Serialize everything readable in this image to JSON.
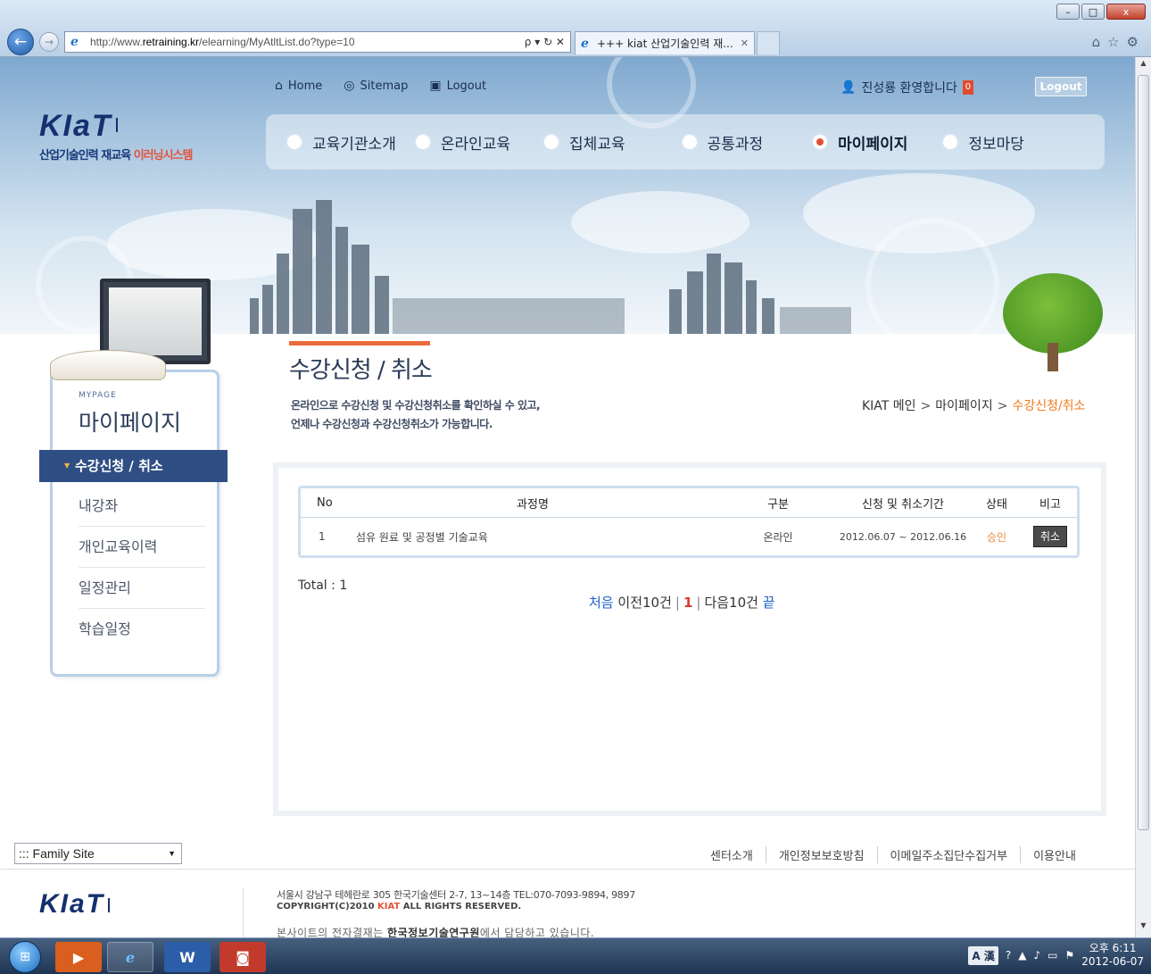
{
  "browser": {
    "url_prefix": "http://www.",
    "url_host": "retraining.kr",
    "url_path": "/elearning/MyAtltList.do?type=10",
    "addr_tools": "ρ ▾ ↻ ✕",
    "tab_title": "+++ kiat 산업기술인력 재...",
    "tab_close": "✕",
    "win_min": "–",
    "win_max": "□",
    "win_close": "x",
    "back_glyph": "←",
    "fwd_glyph": "→"
  },
  "header": {
    "logo_text": "KIaT",
    "logo_sub_main": "산업기술인력 재교육 ",
    "logo_sub_accent": "이러닝시스템",
    "util_links": [
      "Home",
      "Sitemap",
      "Logout"
    ],
    "welcome": "진성룡 환영합니다",
    "welcome_badge": "0",
    "logout_button": "Logout"
  },
  "gnb": {
    "items": [
      "교육기관소개",
      "온라인교육",
      "집체교육",
      "공통과정",
      "마이페이지",
      "정보마당"
    ],
    "active": "마이페이지"
  },
  "snb": {
    "title_en": "MYPAGE",
    "title": "마이페이지",
    "active_item": "수강신청 / 취소",
    "items": [
      "내강좌",
      "개인교육이력",
      "일정관리",
      "학습일정"
    ]
  },
  "content": {
    "page_title": "수강신청 / 취소",
    "desc_line1": "온라인으로 수강신청 및 수강신청취소를 확인하실 수 있고,",
    "desc_line2": "언제나 수강신청과 수강신청취소가 가능합니다.",
    "breadcrumb": [
      "KIAT 메인",
      "마이페이지",
      "수강신청/취소"
    ],
    "breadcrumb_sep": ">",
    "table": {
      "headers": [
        "No",
        "과정명",
        "구분",
        "신청 및 취소기간",
        "상태",
        "비고"
      ],
      "rows": [
        {
          "no": "1",
          "course": "섬유 원료 및 공정별 기술교육",
          "type": "온라인",
          "period": "2012.06.07 ~ 2012.06.16",
          "status": "승인",
          "action": "취소"
        }
      ]
    },
    "total": "Total : 1",
    "pager": {
      "first": "처음",
      "prev": "이전10건",
      "current": "1",
      "next": "다음10건",
      "last": "끝",
      "sep": "|"
    }
  },
  "footer": {
    "family_site": "::: Family Site",
    "links": [
      "센터소개",
      "개인정보보호방침",
      "이메일주소집단수집거부",
      "이용안내"
    ],
    "address": "서울시 강남구 테헤란로 305 한국기술센터 2-7, 13~14층 TEL:070-7093-9894, 9897",
    "copyright_pre": "COPYRIGHT(C)2010 ",
    "copyright_accent": "KIAT",
    "copyright_post": " ALL RIGHTS RESERVED.",
    "notice_pre": "본사이트의 전자결재는 ",
    "notice_bold": "한국정보기술연구원",
    "notice_post": "에서 담당하고 있습니다."
  },
  "taskbar": {
    "ime": "A 漢",
    "clock_time": "오후 6:11",
    "clock_date": "2012-06-07"
  },
  "colors": {
    "accent_orange": "#ea6b3d",
    "nav_blue": "#2f4e83",
    "link_blue": "#1e63c8",
    "status_orange": "#e98a3a"
  }
}
